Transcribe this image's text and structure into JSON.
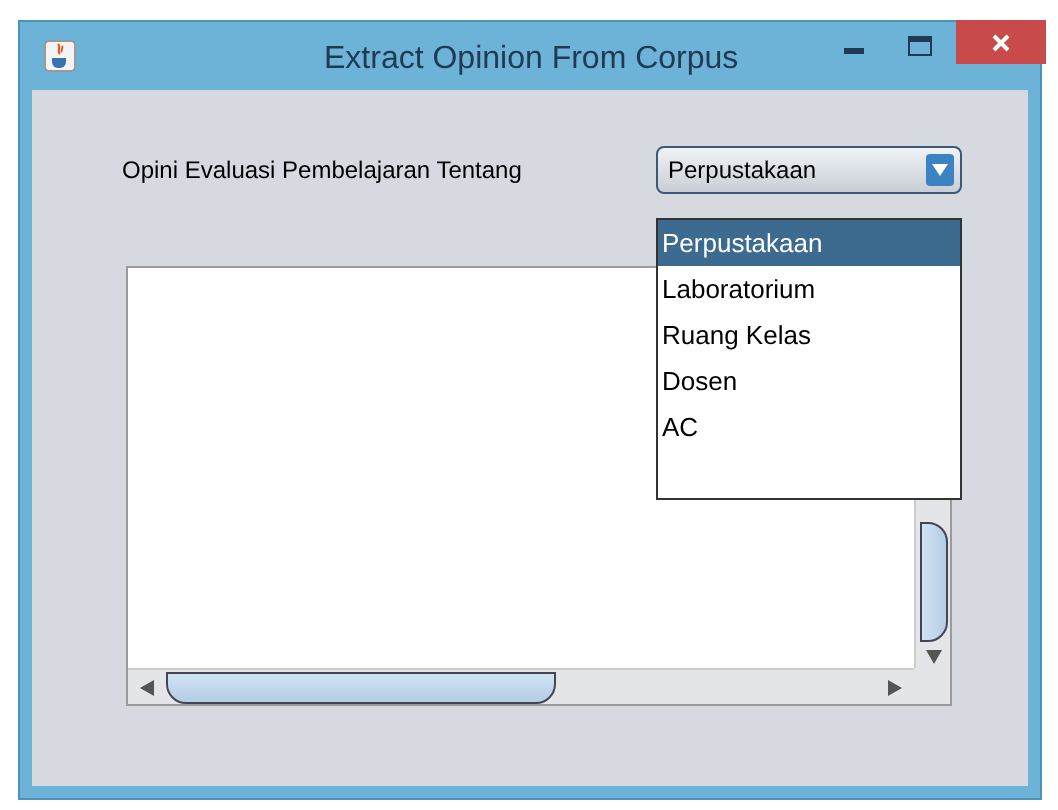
{
  "window": {
    "title": "Extract Opinion From Corpus"
  },
  "form": {
    "label": "Opini Evaluasi Pembelajaran Tentang",
    "combo": {
      "value": "Perpustakaan",
      "expanded": true,
      "options": [
        {
          "label": "Perpustakaan",
          "selected": true
        },
        {
          "label": "Laboratorium",
          "selected": false
        },
        {
          "label": "Ruang Kelas",
          "selected": false
        },
        {
          "label": "Dosen",
          "selected": false
        },
        {
          "label": "AC",
          "selected": false
        }
      ]
    }
  }
}
